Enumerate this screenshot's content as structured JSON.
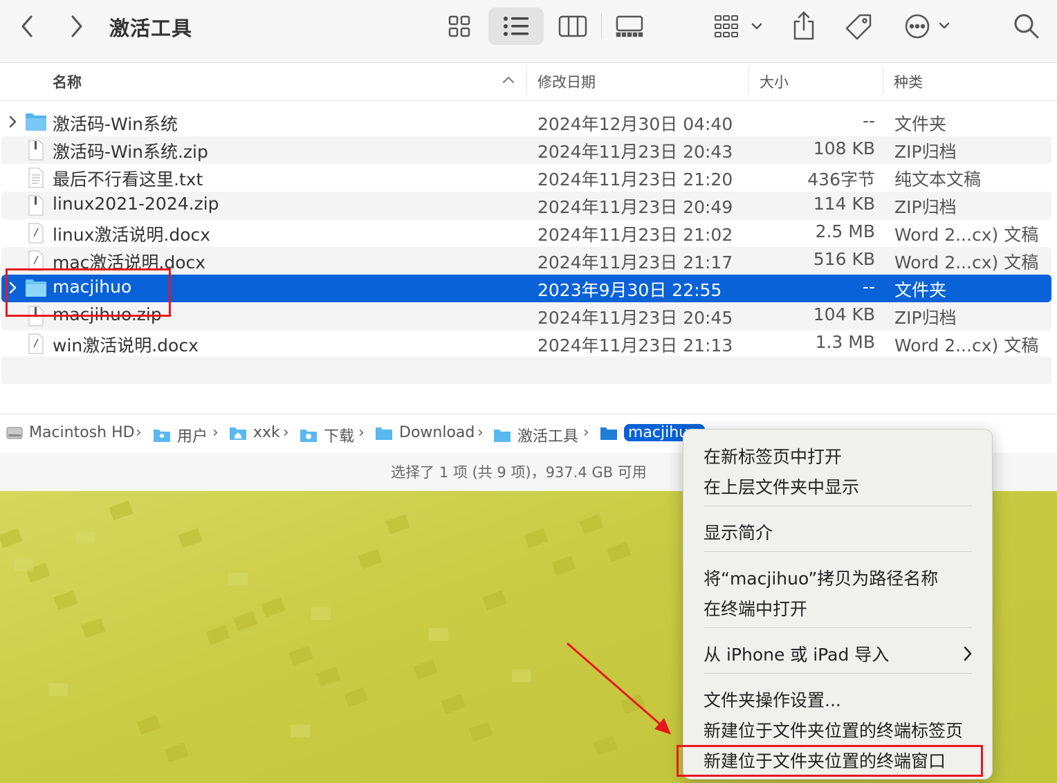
{
  "window": {
    "title": "激活工具"
  },
  "toolbar": {
    "back_icon": "chevron-left-icon",
    "forward_icon": "chevron-right-icon",
    "view_icons": [
      "grid-view-icon",
      "list-view-icon",
      "column-view-icon",
      "gallery-view-icon"
    ],
    "selected_view": "list",
    "group_icon": "group-by-icon",
    "share_icon": "share-icon",
    "tag_icon": "tag-icon",
    "more_icon": "more-actions-icon",
    "search_icon": "search-icon"
  },
  "columns": {
    "name": "名称",
    "date": "修改日期",
    "size": "大小",
    "kind": "种类"
  },
  "files": [
    {
      "name": "激活码-Win系统",
      "date": "2024年12月30日 04:40",
      "size": "--",
      "kind": "文件夹",
      "type": "folder",
      "selected": false
    },
    {
      "name": "激活码-Win系统.zip",
      "date": "2024年11月23日 20:43",
      "size": "108 KB",
      "kind": "ZIP归档",
      "type": "zip",
      "selected": false
    },
    {
      "name": "最后不行看这里.txt",
      "date": "2024年11月23日 21:20",
      "size": "436字节",
      "kind": "纯文本文稿",
      "type": "txt",
      "selected": false
    },
    {
      "name": "linux2021-2024.zip",
      "date": "2024年11月23日 20:49",
      "size": "114 KB",
      "kind": "ZIP归档",
      "type": "zip",
      "selected": false
    },
    {
      "name": "linux激活说明.docx",
      "date": "2024年11月23日 21:02",
      "size": "2.5 MB",
      "kind": "Word 2...cx) 文稿",
      "type": "doc",
      "selected": false
    },
    {
      "name": "mac激活说明.docx",
      "date": "2024年11月23日 21:17",
      "size": "516 KB",
      "kind": "Word 2...cx) 文稿",
      "type": "doc",
      "selected": false
    },
    {
      "name": "macjihuo",
      "date": "2023年9月30日 22:55",
      "size": "--",
      "kind": "文件夹",
      "type": "folder",
      "selected": true
    },
    {
      "name": "macjihuo.zip",
      "date": "2024年11月23日 20:45",
      "size": "104 KB",
      "kind": "ZIP归档",
      "type": "zip",
      "selected": false
    },
    {
      "name": "win激活说明.docx",
      "date": "2024年11月23日 21:13",
      "size": "1.3 MB",
      "kind": "Word 2...cx) 文稿",
      "type": "doc",
      "selected": false
    }
  ],
  "pathbar": {
    "crumbs": [
      "Macintosh HD",
      "用户",
      "xxk",
      "下载",
      "Download",
      "激活工具",
      "macjihuo"
    ]
  },
  "status": {
    "text": "选择了 1 项 (共 9 项)，937.4 GB 可用"
  },
  "context_menu": {
    "items": [
      "在新标签页中打开",
      "在上层文件夹中显示",
      "显示简介",
      "将“macjihuo”拷贝为路径名称",
      "在终端中打开",
      "从 iPhone 或 iPad 导入",
      "文件夹操作设置...",
      "新建位于文件夹位置的终端标签页",
      "新建位于文件夹位置的终端窗口"
    ],
    "submenu_icon": "chevron-right-icon"
  },
  "colors": {
    "selection": "#0a62d8",
    "annotation": "#e8171d",
    "folder": "#5ab8f0"
  }
}
